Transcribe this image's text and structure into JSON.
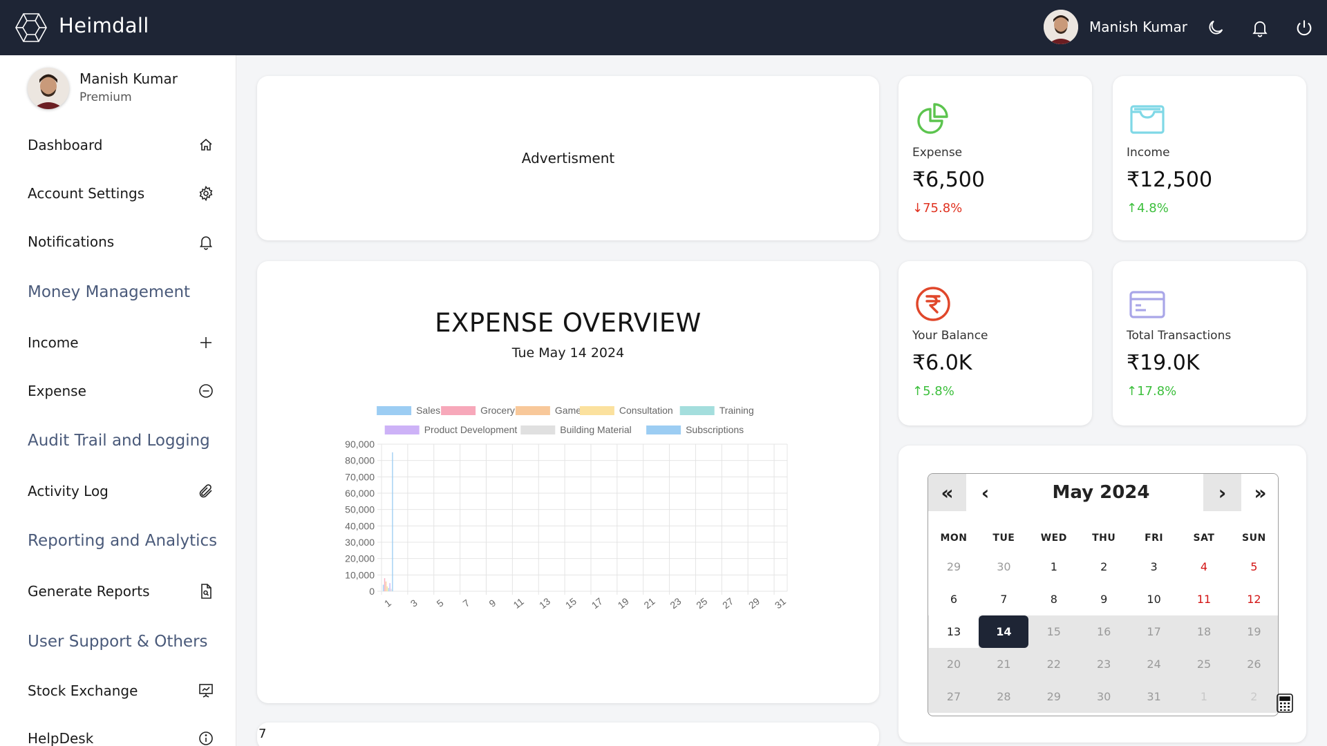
{
  "header": {
    "brand": "Heimdall",
    "user_name": "Manish Kumar",
    "icons": [
      "hexagon-logo-icon",
      "moon-icon",
      "bell-icon",
      "power-icon"
    ]
  },
  "sidebar": {
    "profile": {
      "name": "Manish Kumar",
      "plan": "Premium"
    },
    "items": [
      {
        "label": "Dashboard",
        "icon": "home-icon"
      },
      {
        "label": "Account Settings",
        "icon": "gear-icon"
      },
      {
        "label": "Notifications",
        "icon": "bell-icon"
      },
      {
        "label": "Income",
        "icon": "plus-icon"
      },
      {
        "label": "Expense",
        "icon": "minus-circle-icon"
      },
      {
        "label": "Activity Log",
        "icon": "paperclip-icon"
      },
      {
        "label": "Generate Reports",
        "icon": "report-file-icon"
      },
      {
        "label": "Stock Exchange",
        "icon": "presentation-chart-icon"
      },
      {
        "label": "HelpDesk",
        "icon": "info-circle-icon"
      }
    ],
    "sections": [
      "Money Management",
      "Audit Trail and Logging",
      "Reporting and Analytics",
      "User Support & Others"
    ]
  },
  "main": {
    "ad_text": "Advertisment",
    "bottom_text": "7"
  },
  "stats": [
    {
      "label": "Expense",
      "value": "₹6,500",
      "change": "↓75.8%",
      "trend": "down",
      "icon": "pie-chart-icon",
      "color": "#5cc44e"
    },
    {
      "label": "Income",
      "value": "₹12,500",
      "change": "↑4.8%",
      "trend": "up",
      "icon": "wallet-icon",
      "color": "#7fd8e6"
    },
    {
      "label": "Your Balance",
      "value": "₹6.0K",
      "change": "↑5.8%",
      "trend": "up",
      "icon": "rupee-circle-icon",
      "color": "#e0472b"
    },
    {
      "label": "Total Transactions",
      "value": "₹19.0K",
      "change": "↑17.8%",
      "trend": "up",
      "icon": "credit-card-icon",
      "color": "#a9a6e8"
    }
  ],
  "chart_data": {
    "type": "bar",
    "title": "EXPENSE OVERVIEW",
    "subtitle": "Tue May 14 2024",
    "x": [
      1,
      2,
      3,
      4,
      5,
      6,
      7,
      8,
      9,
      10,
      11,
      12,
      13,
      14,
      15,
      16,
      17,
      18,
      19,
      20,
      21,
      22,
      23,
      24,
      25,
      26,
      27,
      28,
      29,
      30,
      31
    ],
    "x_tick_labels": [
      "1",
      "3",
      "5",
      "7",
      "9",
      "11",
      "13",
      "15",
      "17",
      "19",
      "21",
      "23",
      "25",
      "27",
      "29",
      "31"
    ],
    "ylim": [
      0,
      90000
    ],
    "y_ticks": [
      "0",
      "10,000",
      "20,000",
      "30,000",
      "40,000",
      "50,000",
      "60,000",
      "70,000",
      "80,000",
      "90,000"
    ],
    "grid": true,
    "legend_position": "top",
    "series": [
      {
        "name": "Sales",
        "color": "#9ccdf3",
        "values": [
          4000,
          0,
          0,
          0,
          0,
          0,
          0,
          0,
          0,
          0,
          0,
          0,
          0,
          0,
          0,
          0,
          0,
          0,
          0,
          0,
          0,
          0,
          0,
          0,
          0,
          0,
          0,
          0,
          0,
          0,
          0
        ]
      },
      {
        "name": "Grocery",
        "color": "#f7a8ba",
        "values": [
          8000,
          0,
          0,
          0,
          0,
          0,
          0,
          0,
          0,
          0,
          0,
          0,
          0,
          0,
          0,
          0,
          0,
          0,
          0,
          0,
          0,
          0,
          0,
          0,
          0,
          0,
          0,
          0,
          0,
          0,
          0
        ]
      },
      {
        "name": "Games",
        "color": "#f8c89a",
        "values": [
          6000,
          0,
          0,
          0,
          0,
          0,
          0,
          0,
          0,
          0,
          0,
          0,
          0,
          0,
          0,
          0,
          0,
          0,
          0,
          0,
          0,
          0,
          0,
          0,
          0,
          0,
          0,
          0,
          0,
          0,
          0
        ]
      },
      {
        "name": "Consultation",
        "color": "#fbe19e",
        "values": [
          3000,
          0,
          0,
          0,
          0,
          0,
          0,
          0,
          0,
          0,
          0,
          0,
          0,
          0,
          0,
          0,
          0,
          0,
          0,
          0,
          0,
          0,
          0,
          0,
          0,
          0,
          0,
          0,
          0,
          0,
          0
        ]
      },
      {
        "name": "Training",
        "color": "#a4dedd",
        "values": [
          2000,
          0,
          0,
          0,
          0,
          0,
          0,
          0,
          0,
          0,
          0,
          0,
          0,
          0,
          0,
          0,
          0,
          0,
          0,
          0,
          0,
          0,
          0,
          0,
          0,
          0,
          0,
          0,
          0,
          0,
          0
        ]
      },
      {
        "name": "Product Development",
        "color": "#cdb2f7",
        "values": [
          5000,
          0,
          0,
          0,
          0,
          0,
          0,
          0,
          0,
          0,
          0,
          0,
          0,
          0,
          0,
          0,
          0,
          0,
          0,
          0,
          0,
          0,
          0,
          0,
          0,
          0,
          0,
          0,
          0,
          0,
          0
        ]
      },
      {
        "name": "Building Material",
        "color": "#e0e0e0",
        "values": [
          1500,
          0,
          0,
          0,
          0,
          0,
          0,
          0,
          0,
          0,
          0,
          0,
          0,
          0,
          0,
          0,
          0,
          0,
          0,
          0,
          0,
          0,
          0,
          0,
          0,
          0,
          0,
          0,
          0,
          0,
          0
        ]
      },
      {
        "name": "Subscriptions",
        "color": "#9ccdf3",
        "values": [
          85000,
          0,
          0,
          0,
          0,
          0,
          0,
          0,
          0,
          0,
          0,
          0,
          0,
          0,
          0,
          0,
          0,
          0,
          0,
          0,
          0,
          0,
          0,
          0,
          0,
          0,
          0,
          0,
          0,
          0,
          0
        ]
      }
    ]
  },
  "calendar": {
    "prev_year": "«",
    "prev_month": "‹",
    "month_label": "May 2024",
    "next_month": "›",
    "next_year": "»",
    "weekdays": [
      "MON",
      "TUE",
      "WED",
      "THU",
      "FRI",
      "SAT",
      "SUN"
    ],
    "weeks": [
      [
        "29",
        "30",
        "1",
        "2",
        "3",
        "4",
        "5"
      ],
      [
        "6",
        "7",
        "8",
        "9",
        "10",
        "11",
        "12"
      ],
      [
        "13",
        "14",
        "15",
        "16",
        "17",
        "18",
        "19"
      ],
      [
        "20",
        "21",
        "22",
        "23",
        "24",
        "25",
        "26"
      ],
      [
        "27",
        "28",
        "29",
        "30",
        "31",
        "1",
        "2"
      ]
    ],
    "selected": "14",
    "calculator_icon": "calculator-icon"
  }
}
